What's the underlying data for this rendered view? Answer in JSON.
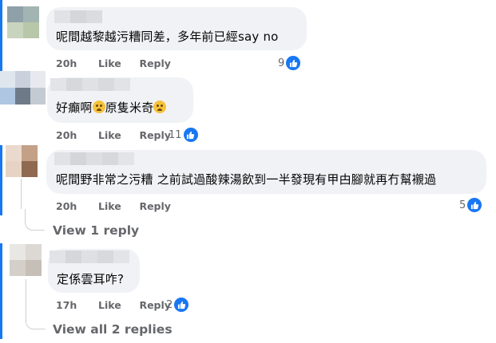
{
  "comments": [
    {
      "text": "呢間越黎越污糟同差，多年前已經say no",
      "time": "20h",
      "like": "Like",
      "reply": "Reply",
      "reactions": "9"
    },
    {
      "text_a": "好癲啊",
      "text_b": "原隻米奇",
      "time": "20h",
      "like": "Like",
      "reply": "Reply",
      "reactions": "11"
    },
    {
      "text": "呢間野非常之污糟 之前試過酸辣湯飲到一半發現有甲甴腳就再冇幫襯過",
      "time": "20h",
      "like": "Like",
      "reply": "Reply",
      "reactions": "5",
      "view_replies": "View 1 reply"
    },
    {
      "text": "定係雲耳咋?",
      "time": "17h",
      "like": "Like",
      "reply": "Reply",
      "reactions": "2",
      "view_replies": "View all 2 replies"
    }
  ],
  "icons": {
    "reaction": "like-thumb-icon",
    "emoji": "crying-face-emoji-icon"
  },
  "colors": {
    "accent": "#1877f2",
    "bubble": "#f0f2f5",
    "meta": "#65676b"
  }
}
